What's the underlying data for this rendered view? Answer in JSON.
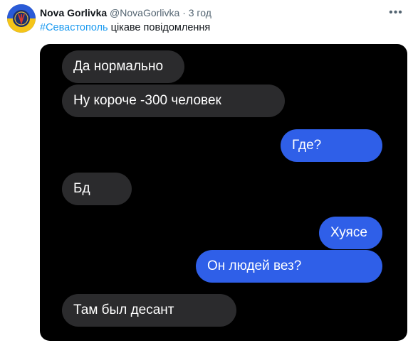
{
  "tweet": {
    "display_name": "Nova Gorlivka",
    "handle": "@NovaGorlivka",
    "separator": "·",
    "time": "3 год",
    "more_icon": "more-horizontal-icon",
    "hashtag": "#Севастополь",
    "text_rest": " цікаве повідомлення"
  },
  "chat": {
    "messages": [
      {
        "side": "incoming",
        "text": "Да нормально"
      },
      {
        "side": "incoming",
        "text": "Ну короче -300 человек"
      },
      {
        "side": "outgoing",
        "text": "Где?"
      },
      {
        "side": "incoming",
        "text": "Бд"
      },
      {
        "side": "outgoing",
        "text": "Хуясе"
      },
      {
        "side": "outgoing",
        "text": "Он людей вез?"
      },
      {
        "side": "incoming",
        "text": "Там был десант"
      }
    ]
  },
  "colors": {
    "incoming_bubble": "#2b2b2d",
    "outgoing_bubble": "#2f5fe8",
    "hashtag": "#1d9bf0"
  }
}
